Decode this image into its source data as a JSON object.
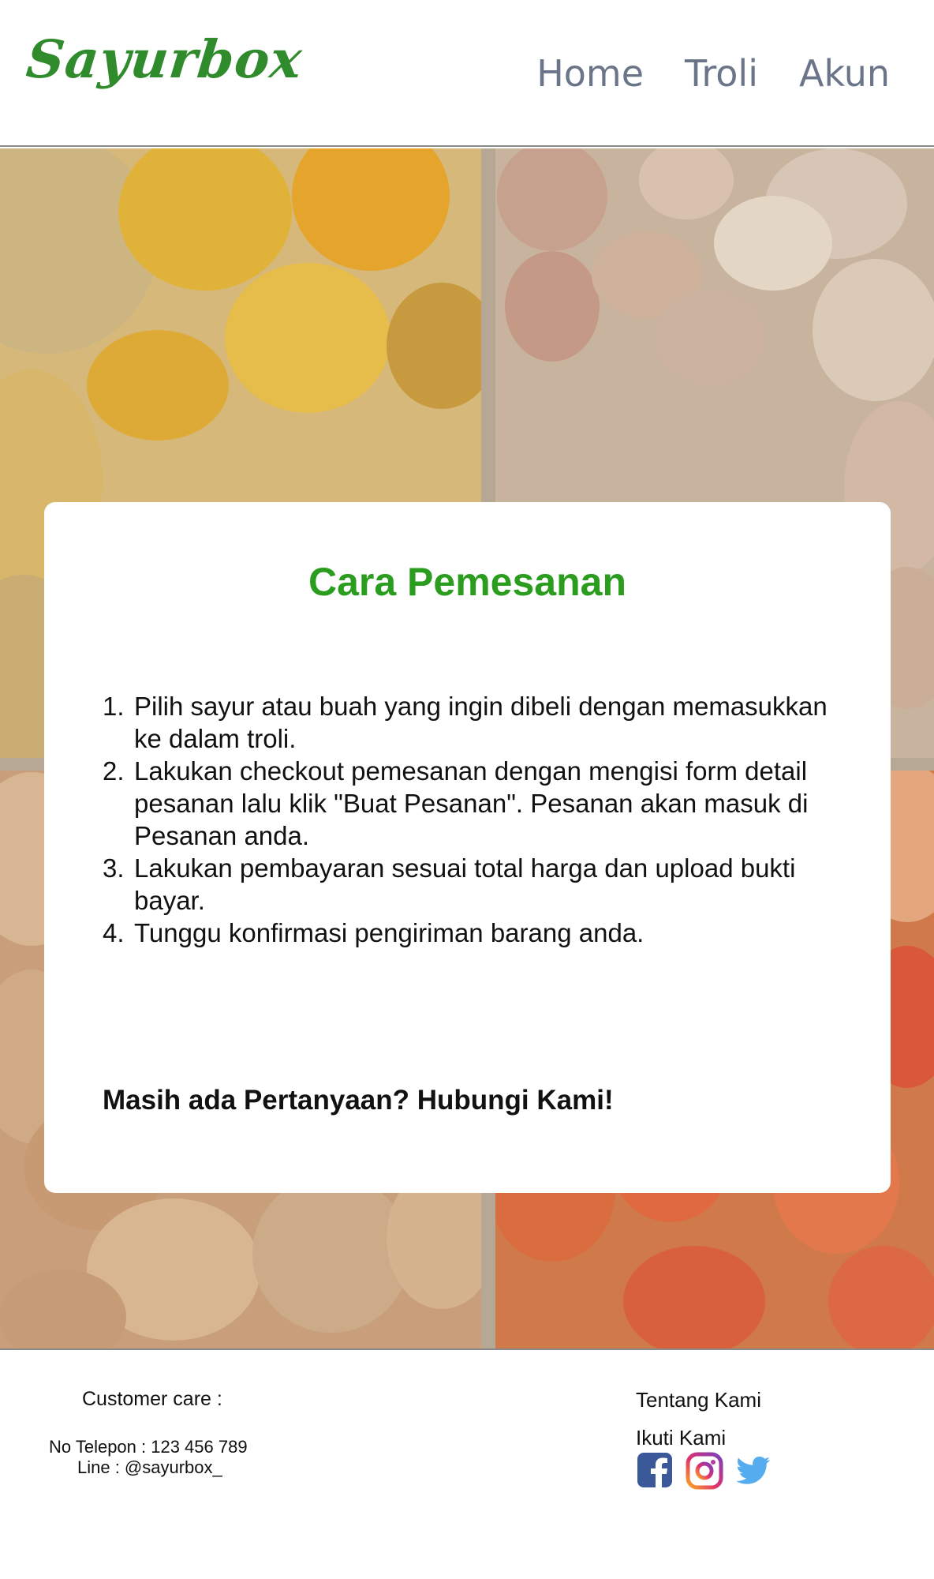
{
  "header": {
    "logo": "Sayurbox",
    "nav": [
      {
        "label": "Home"
      },
      {
        "label": "Troli"
      },
      {
        "label": "Akun"
      }
    ]
  },
  "card": {
    "title": "Cara Pemesanan",
    "steps": [
      "Pilih sayur atau buah yang ingin dibeli dengan memasukkan ke dalam troli.",
      "Lakukan checkout pemesanan dengan mengisi form detail pesanan lalu klik \"Buat Pesanan\". Pesanan akan masuk di Pesanan anda.",
      "Lakukan pembayaran sesuai total harga dan upload bukti bayar.",
      "Tunggu konfirmasi pengiriman barang anda."
    ],
    "cta": "Masih ada Pertanyaan? Hubungi Kami!"
  },
  "footer": {
    "customer_care_title": "Customer care :",
    "phone": "No Telepon : 123 456 789",
    "line": "Line : @sayurbox_",
    "about": "Tentang Kami",
    "follow": "Ikuti Kami",
    "socials": [
      {
        "icon": "facebook-icon",
        "color": "#3b5998"
      },
      {
        "icon": "instagram-icon",
        "color": "#c13584"
      },
      {
        "icon": "twitter-icon",
        "color": "#55acee"
      }
    ]
  },
  "colors": {
    "brand_green": "#2f8b2c",
    "title_green": "#2a9d1e",
    "nav_gray": "#6b7589"
  }
}
